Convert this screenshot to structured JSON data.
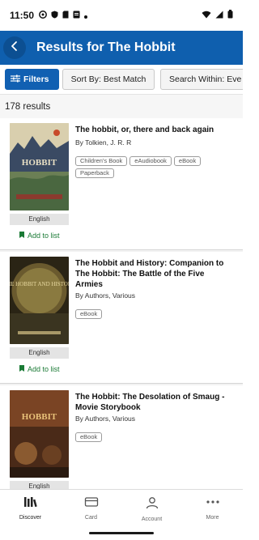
{
  "status_bar": {
    "time": "11:50"
  },
  "app_bar": {
    "title": "Results for The Hobbit"
  },
  "filters": {
    "filters_label": "Filters",
    "sort_label": "Sort By: Best Match",
    "search_within_label": "Search Within: Eve"
  },
  "results": {
    "count_label": "178 results",
    "items": [
      {
        "title": "The hobbit, or, there and back again",
        "author": "By Tolkien, J. R. R",
        "tags": [
          "Children's Book",
          "eAudiobook",
          "eBook",
          "Paperback"
        ],
        "language": "English",
        "add_to_list": "Add to list",
        "cover_title": "HOBBIT"
      },
      {
        "title": "The Hobbit and History: Companion to The Hobbit: The Battle of the Five Armies",
        "author": "By Authors, Various",
        "tags": [
          "eBook"
        ],
        "language": "English",
        "add_to_list": "Add to list",
        "cover_title": "THE HOBBIT AND HISTORY"
      },
      {
        "title": "The Hobbit: The Desolation of Smaug - Movie Storybook",
        "author": "By Authors, Various",
        "tags": [
          "eBook"
        ],
        "language": "English",
        "cover_title": "HOBBIT"
      }
    ]
  },
  "bottom_nav": [
    {
      "label": "Discover",
      "icon": "discover-icon"
    },
    {
      "label": "Card",
      "icon": "card-icon"
    },
    {
      "label": "Account",
      "icon": "account-icon"
    },
    {
      "label": "More",
      "icon": "more-icon"
    }
  ],
  "colors": {
    "primary": "#0f5fae",
    "add_to_list_green": "#1a7a35"
  }
}
